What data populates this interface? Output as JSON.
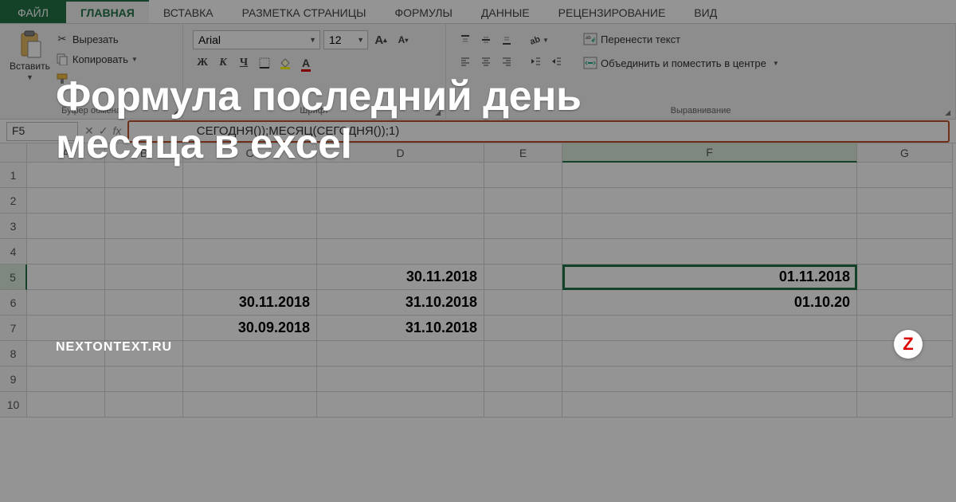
{
  "tabs": {
    "file": "ФАЙЛ",
    "home": "ГЛАВНАЯ",
    "insert": "ВСТАВКА",
    "layout": "РАЗМЕТКА СТРАНИЦЫ",
    "formulas": "ФОРМУЛЫ",
    "data": "ДАННЫЕ",
    "review": "РЕЦЕНЗИРОВАНИЕ",
    "view": "ВИД"
  },
  "ribbon": {
    "paste": "Вставить",
    "cut": "Вырезать",
    "copy": "Копировать",
    "clipboard_group": "Буфер обмена",
    "font_name": "Arial",
    "font_size": "12",
    "font_group": "Шрифт",
    "align_group": "Выравнивание",
    "wrap_text": "Перенести текст",
    "merge_center": "Объединить и поместить в центре"
  },
  "fbar": {
    "name_box": "F5",
    "formula_visible": "СЕГОДНЯ());МЕСЯЦ(СЕГОДНЯ());1)"
  },
  "sheet": {
    "columns": [
      "A",
      "B",
      "C",
      "D",
      "E",
      "F",
      "G"
    ],
    "rows": [
      "1",
      "2",
      "3",
      "4",
      "5",
      "6",
      "7",
      "8",
      "9",
      "10"
    ],
    "cells": {
      "D5": "30.11.2018",
      "F5": "01.11.2018",
      "C6": "30.11.2018",
      "D6": "31.10.2018",
      "F6": "01.10.20",
      "C7": "30.09.2018",
      "D7": "31.10.2018"
    },
    "active": "F5"
  },
  "overlay": {
    "headline_l1": "Формула последний день",
    "headline_l2": "месяца в excel",
    "brand": "NEXTONTEXT.RU",
    "badge": "Z"
  }
}
